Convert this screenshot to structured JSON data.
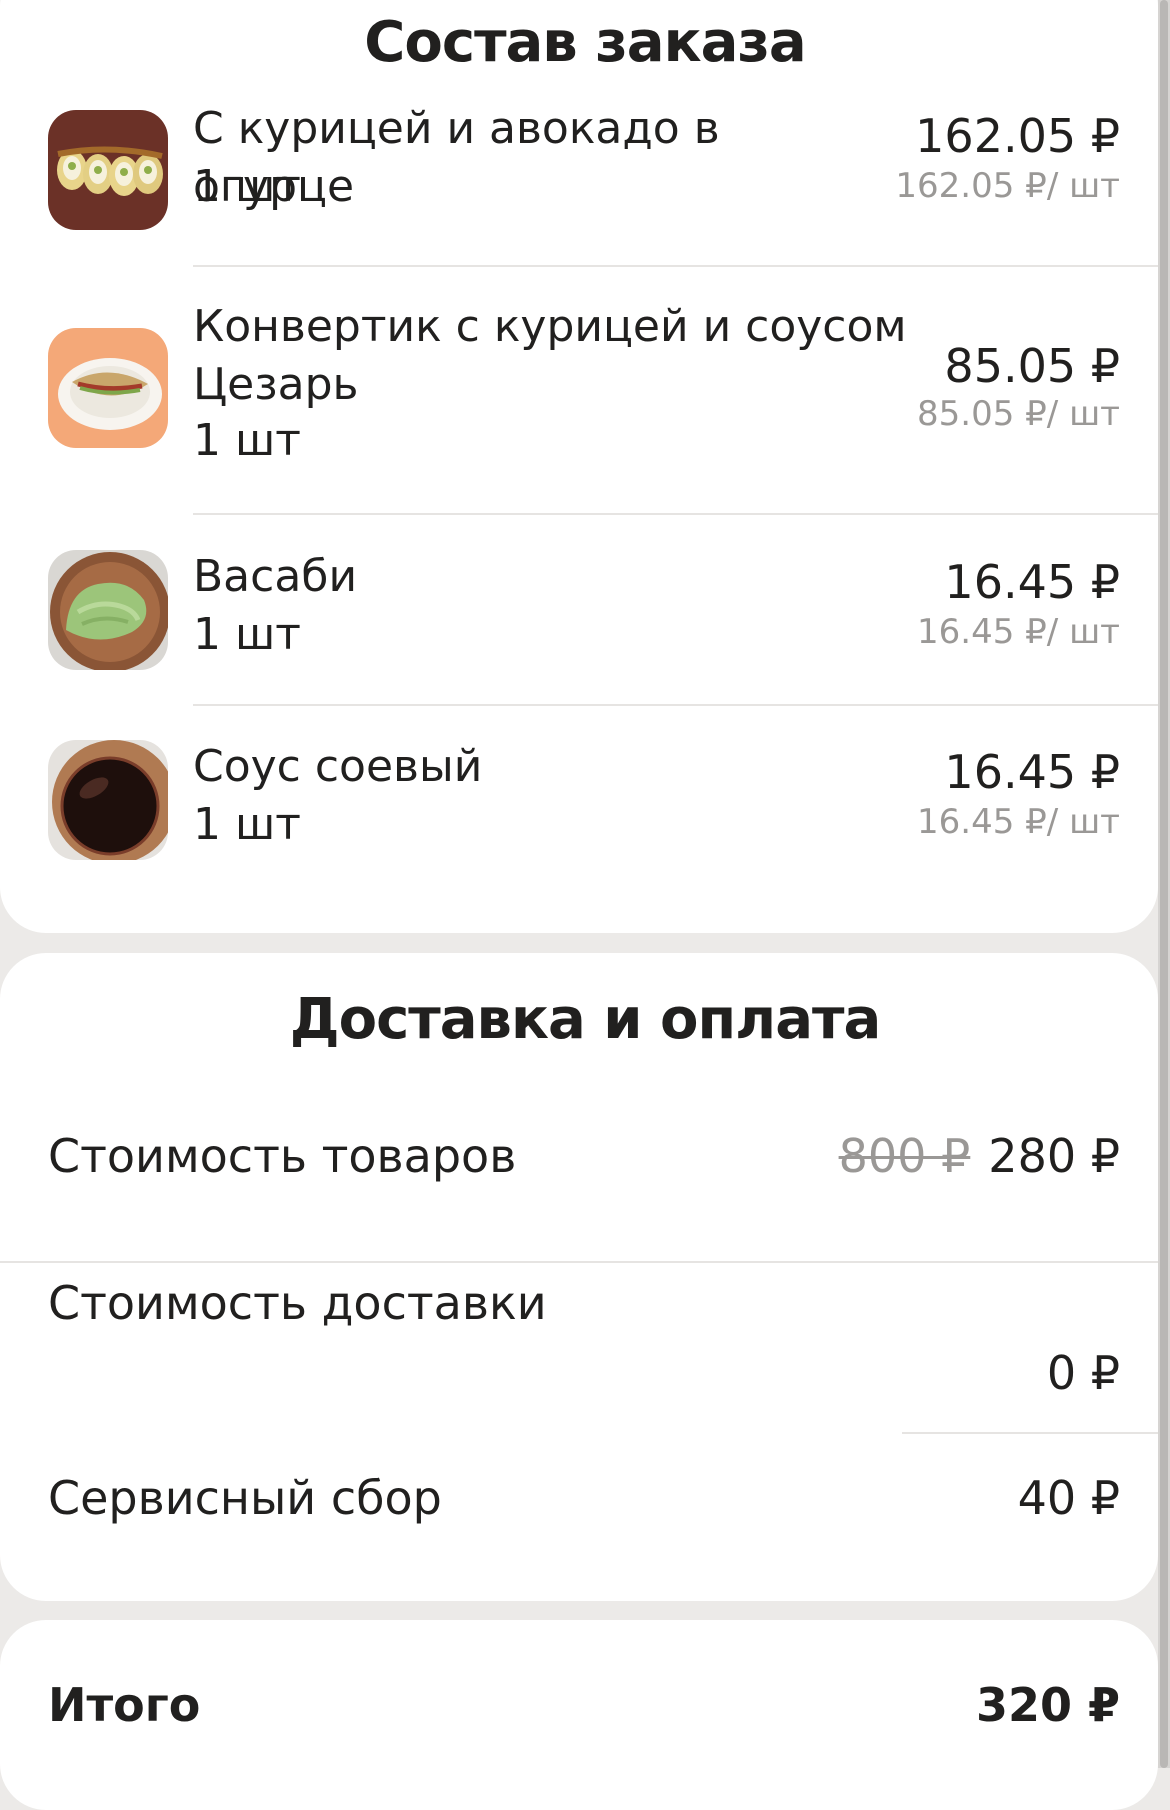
{
  "order": {
    "title": "Состав заказа",
    "items": [
      {
        "image": "sushi-roll-cucumber-image",
        "name": "С курицей и авокадо в огурце",
        "qty": "1 шт",
        "total": "162.05 ₽",
        "unit_price": "162.05 ₽/ шт"
      },
      {
        "image": "chicken-wrap-image",
        "name": "Конвертик с курицей и соусом Цезарь",
        "qty": "1 шт",
        "total": "85.05 ₽",
        "unit_price": "85.05 ₽/ шт"
      },
      {
        "image": "wasabi-bowl-image",
        "name": "Васаби",
        "qty": "1 шт",
        "total": "16.45 ₽",
        "unit_price": "16.45 ₽/ шт"
      },
      {
        "image": "soy-sauce-bowl-image",
        "name": "Соус соевый",
        "qty": "1 шт",
        "total": "16.45 ₽",
        "unit_price": "16.45 ₽/ шт"
      }
    ]
  },
  "delivery": {
    "title": "Доставка и оплата",
    "goods_cost_label": "Стоимость товаров",
    "goods_cost_old": "800 ₽",
    "goods_cost_new": "280 ₽",
    "delivery_cost_label": "Стоимость доставки",
    "delivery_cost_value": "0 ₽",
    "service_fee_label": "Сервисный сбор",
    "service_fee_value": "40 ₽"
  },
  "total": {
    "label": "Итого",
    "value": "320 ₽"
  },
  "colors": {
    "background": "#eceae8",
    "card": "#ffffff",
    "text": "#21201f",
    "muted": "#9a9896"
  }
}
